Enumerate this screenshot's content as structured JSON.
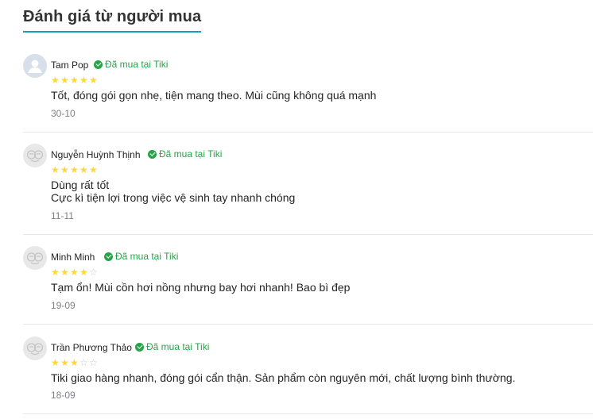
{
  "section_title": "Đánh giá từ người mua",
  "reviews": [
    {
      "name": "Tam Pop",
      "badge": "Đã mua tại Tiki",
      "rating": 5,
      "lines": [
        "Tốt, đóng gói gọn nhẹ, tiện mang theo. Mùi cũng không quá mạnh"
      ],
      "date": "30-10",
      "avatar": "user-avatar-icon"
    },
    {
      "name": "Nguyễn Huỳnh Thịnh",
      "badge": "Đã mua tại Tiki",
      "rating": 5,
      "lines": [
        "Dùng rất tốt",
        "Cực kì tiện lợi trong việc vệ sinh tay nhanh chóng"
      ],
      "date": "11-11",
      "avatar": "default-avatar-icon"
    },
    {
      "name": "Minh Minh",
      "badge": "Đã mua tại Tiki",
      "rating": 4,
      "lines": [
        "Tạm ổn! Mùi cồn hơi nồng nhưng bay hơi nhanh! Bao bì đẹp"
      ],
      "date": "19-09",
      "avatar": "default-avatar-icon"
    },
    {
      "name": "Trần Phương Thảo",
      "badge": "Đã mua tại Tiki",
      "rating": 3,
      "lines": [
        "Tiki giao hàng nhanh, đóng gói cẩn thận. Sản phẩm còn nguyên mới, chất lượng bình thường."
      ],
      "date": "18-09",
      "avatar": "default-avatar-icon"
    }
  ],
  "colors": {
    "accent_underline": "#1b9cbf",
    "verified_green": "#27a348",
    "star_filled": "#fdd835",
    "star_empty": "#c8c8c8"
  }
}
